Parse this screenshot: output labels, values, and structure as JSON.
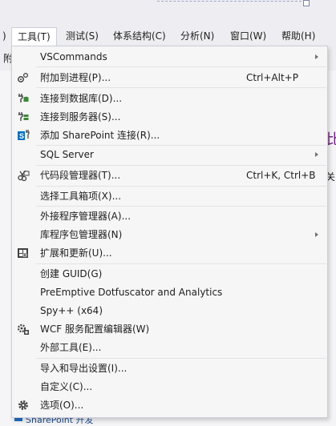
{
  "menubar": {
    "items": [
      {
        "label": "工具(T)",
        "active": true
      },
      {
        "label": "测试(S)"
      },
      {
        "label": "体系结构(C)"
      },
      {
        "label": "分析(N)"
      },
      {
        "label": "窗口(W)"
      },
      {
        "label": "帮助(H)"
      }
    ]
  },
  "background": {
    "toolbar_text": "附",
    "right_partial_purple": "比",
    "right_partial_dark": "关",
    "bottom_partial": "SharePoint 开发"
  },
  "tools_menu": {
    "items": [
      {
        "label": "VSCommands",
        "submenu": true
      },
      {
        "label": "附加到进程(P)...",
        "shortcut": "Ctrl+Alt+P",
        "icon": "attach-process-icon"
      },
      {
        "label": "连接到数据库(D)...",
        "icon": "connect-database-icon"
      },
      {
        "label": "连接到服务器(S)...",
        "icon": "connect-server-icon"
      },
      {
        "label": "添加 SharePoint 连接(R)...",
        "icon": "sharepoint-connection-icon"
      },
      {
        "label": "SQL Server",
        "submenu": true
      },
      {
        "label": "代码段管理器(T)...",
        "shortcut": "Ctrl+K, Ctrl+B",
        "icon": "code-snippet-icon"
      },
      {
        "label": "选择工具箱项(X)..."
      },
      {
        "label": "外接程序管理器(A)..."
      },
      {
        "label": "库程序包管理器(N)",
        "submenu": true
      },
      {
        "label": "扩展和更新(U)...",
        "icon": "extensions-icon"
      },
      {
        "label": "创建 GUID(G)"
      },
      {
        "label": "PreEmptive Dotfuscator and Analytics"
      },
      {
        "label": "Spy++ (x64)"
      },
      {
        "label": "WCF 服务配置编辑器(W)",
        "icon": "wcf-config-icon"
      },
      {
        "label": "外部工具(E)..."
      },
      {
        "label": "导入和导出设置(I)..."
      },
      {
        "label": "自定义(C)..."
      },
      {
        "label": "选项(O)...",
        "icon": "options-gear-icon"
      }
    ]
  }
}
